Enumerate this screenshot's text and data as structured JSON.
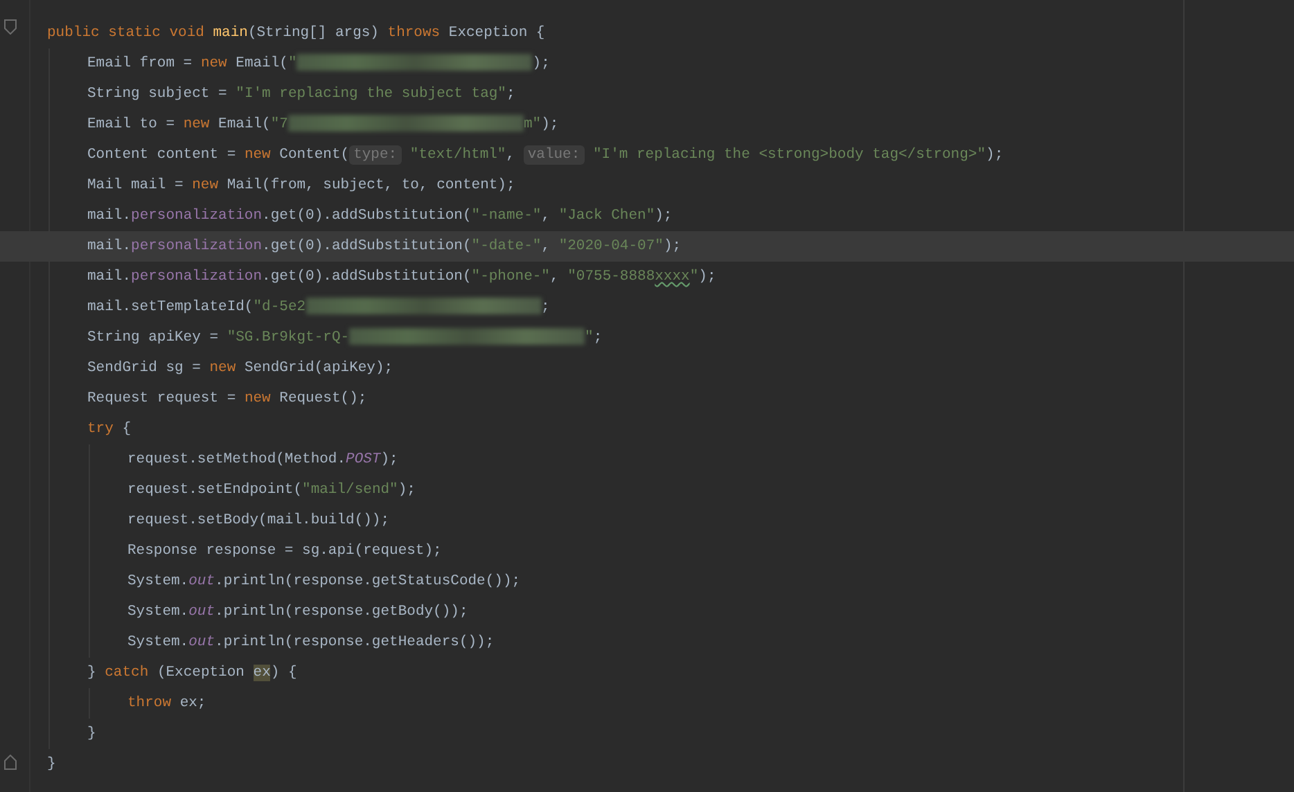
{
  "editor": {
    "lines": [
      {
        "current": false,
        "tokens": [
          {
            "kind": "keyword",
            "text": "public static void"
          },
          {
            "kind": "method",
            "text": " main"
          },
          {
            "kind": "plain",
            "text": "(String[] args)"
          },
          {
            "kind": "keyword",
            "text": " throws"
          },
          {
            "kind": "plain",
            "text": " Exception {"
          }
        ],
        "children": [
          {
            "current": false,
            "tokens": [
              {
                "kind": "plain",
                "text": "Email from ="
              },
              {
                "kind": "keyword",
                "text": " new"
              },
              {
                "kind": "plain",
                "text": " Email("
              },
              {
                "kind": "string",
                "text": "\""
              },
              {
                "kind": "redacted"
              },
              {
                "kind": "plain",
                "text": ");"
              }
            ]
          },
          {
            "current": false,
            "tokens": [
              {
                "kind": "plain",
                "text": "String subject ="
              },
              {
                "kind": "string",
                "text": " \"I'm replacing the subject tag\""
              },
              {
                "kind": "plain",
                "text": ";"
              }
            ]
          },
          {
            "current": false,
            "tokens": [
              {
                "kind": "plain",
                "text": "Email to ="
              },
              {
                "kind": "keyword",
                "text": " new"
              },
              {
                "kind": "plain",
                "text": " Email("
              },
              {
                "kind": "string",
                "text": "\"7"
              },
              {
                "kind": "redacted"
              },
              {
                "kind": "string",
                "text": "m\""
              },
              {
                "kind": "plain",
                "text": ");"
              }
            ]
          },
          {
            "current": false,
            "tokens": [
              {
                "kind": "plain",
                "text": "Content content ="
              },
              {
                "kind": "keyword",
                "text": " new"
              },
              {
                "kind": "plain",
                "text": " Content("
              },
              {
                "kind": "hint",
                "text": "type:"
              },
              {
                "kind": "string",
                "text": " \"text/html\""
              },
              {
                "kind": "plain",
                "text": ","
              },
              {
                "kind": "hint",
                "text": " value:"
              },
              {
                "kind": "string",
                "text": " \"I'm replacing the <strong>body tag</strong>\""
              },
              {
                "kind": "plain",
                "text": ");"
              }
            ]
          },
          {
            "current": false,
            "tokens": [
              {
                "kind": "plain",
                "text": "Mail mail ="
              },
              {
                "kind": "keyword",
                "text": " new"
              },
              {
                "kind": "plain",
                "text": " Mail(from, subject, to, content);"
              }
            ]
          },
          {
            "current": false,
            "tokens": [
              {
                "kind": "plain",
                "text": "mail."
              },
              {
                "kind": "field",
                "text": "personalization"
              },
              {
                "kind": "plain",
                "text": ".get(0).addSubstitution("
              },
              {
                "kind": "string",
                "text": "\"-name-\""
              },
              {
                "kind": "plain",
                "text": ","
              },
              {
                "kind": "string",
                "text": " \"Jack Chen\""
              },
              {
                "kind": "plain",
                "text": ");"
              }
            ]
          },
          {
            "current": true,
            "tokens": [
              {
                "kind": "plain",
                "text": "mail."
              },
              {
                "kind": "field",
                "text": "personalization"
              },
              {
                "kind": "plain",
                "text": ".get(0).addSubstitution("
              },
              {
                "kind": "string",
                "text": "\"-date-\""
              },
              {
                "kind": "plain",
                "text": ","
              },
              {
                "kind": "string",
                "text": " \"2020-04-07\""
              },
              {
                "kind": "plain",
                "text": ");"
              }
            ]
          },
          {
            "current": false,
            "tokens": [
              {
                "kind": "plain",
                "text": "mail."
              },
              {
                "kind": "field",
                "text": "personalization"
              },
              {
                "kind": "plain",
                "text": ".get(0).addSubstitution("
              },
              {
                "kind": "string",
                "text": "\"-phone-\""
              },
              {
                "kind": "plain",
                "text": ","
              },
              {
                "kind": "string",
                "text": " \"0755-8888"
              },
              {
                "kind": "typo",
                "text": "xxxx"
              },
              {
                "kind": "string",
                "text": "\""
              },
              {
                "kind": "plain",
                "text": ");"
              }
            ]
          },
          {
            "current": false,
            "tokens": [
              {
                "kind": "plain",
                "text": "mail.setTemplateId("
              },
              {
                "kind": "string",
                "text": "\"d-5e2"
              },
              {
                "kind": "redacted"
              },
              {
                "kind": "plain",
                "text": ";"
              }
            ]
          },
          {
            "current": false,
            "tokens": [
              {
                "kind": "plain",
                "text": "String apiKey ="
              },
              {
                "kind": "string",
                "text": " \"SG.Br9kgt-rQ-"
              },
              {
                "kind": "redacted"
              },
              {
                "kind": "string",
                "text": "\""
              },
              {
                "kind": "plain",
                "text": ";"
              }
            ]
          },
          {
            "current": false,
            "tokens": [
              {
                "kind": "plain",
                "text": "SendGrid sg ="
              },
              {
                "kind": "keyword",
                "text": " new"
              },
              {
                "kind": "plain",
                "text": " SendGrid(apiKey);"
              }
            ]
          },
          {
            "current": false,
            "tokens": [
              {
                "kind": "plain",
                "text": "Request request ="
              },
              {
                "kind": "keyword",
                "text": " new"
              },
              {
                "kind": "plain",
                "text": " Request();"
              }
            ]
          },
          {
            "current": false,
            "tokens": [
              {
                "kind": "keyword",
                "text": "try"
              },
              {
                "kind": "plain",
                "text": " {"
              }
            ],
            "children": [
              {
                "current": false,
                "tokens": [
                  {
                    "kind": "plain",
                    "text": "request.setMethod(Method."
                  },
                  {
                    "kind": "static",
                    "text": "POST"
                  },
                  {
                    "kind": "plain",
                    "text": ");"
                  }
                ]
              },
              {
                "current": false,
                "tokens": [
                  {
                    "kind": "plain",
                    "text": "request.setEndpoint("
                  },
                  {
                    "kind": "string",
                    "text": "\"mail/send\""
                  },
                  {
                    "kind": "plain",
                    "text": ");"
                  }
                ]
              },
              {
                "current": false,
                "tokens": [
                  {
                    "kind": "plain",
                    "text": "request.setBody(mail.build());"
                  }
                ]
              },
              {
                "current": false,
                "tokens": [
                  {
                    "kind": "plain",
                    "text": "Response response = sg.api(request);"
                  }
                ]
              },
              {
                "current": false,
                "tokens": [
                  {
                    "kind": "plain",
                    "text": "System."
                  },
                  {
                    "kind": "static",
                    "text": "out"
                  },
                  {
                    "kind": "plain",
                    "text": ".println(response.getStatusCode());"
                  }
                ]
              },
              {
                "current": false,
                "tokens": [
                  {
                    "kind": "plain",
                    "text": "System."
                  },
                  {
                    "kind": "static",
                    "text": "out"
                  },
                  {
                    "kind": "plain",
                    "text": ".println(response.getBody());"
                  }
                ]
              },
              {
                "current": false,
                "tokens": [
                  {
                    "kind": "plain",
                    "text": "System."
                  },
                  {
                    "kind": "static",
                    "text": "out"
                  },
                  {
                    "kind": "plain",
                    "text": ".println(response.getHeaders());"
                  }
                ]
              }
            ]
          },
          {
            "current": false,
            "tokens": [
              {
                "kind": "plain",
                "text": "}"
              },
              {
                "kind": "keyword",
                "text": " catch"
              },
              {
                "kind": "plain",
                "text": " (Exception"
              },
              {
                "kind": "usage",
                "text": " ex"
              },
              {
                "kind": "plain",
                "text": ") {"
              }
            ],
            "children": [
              {
                "current": false,
                "tokens": [
                  {
                    "kind": "keyword",
                    "text": "throw"
                  },
                  {
                    "kind": "plain",
                    "text": " ex;"
                  }
                ]
              }
            ]
          },
          {
            "current": false,
            "tokens": [
              {
                "kind": "plain",
                "text": "}"
              }
            ]
          }
        ]
      },
      {
        "current": false,
        "tokens": [
          {
            "kind": "plain",
            "text": "}"
          }
        ]
      }
    ]
  }
}
